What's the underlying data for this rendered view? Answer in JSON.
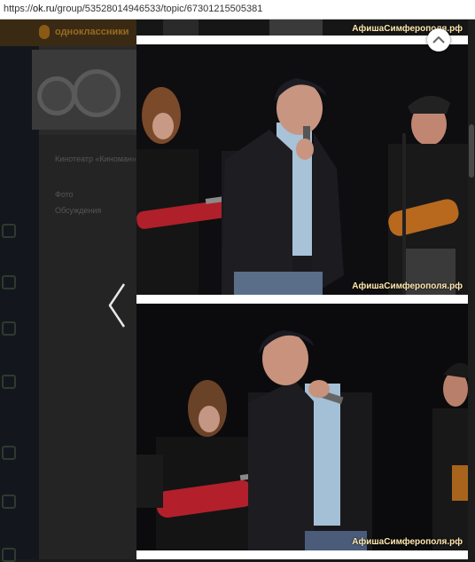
{
  "browser": {
    "url_prefix": "https://",
    "url_host": "ok.ru",
    "url_path": "/group/53528014946533/topic/67301215505381"
  },
  "background_page": {
    "brand": "одноклассники",
    "row1": "Кинотеатр «Киноман»",
    "row2": "Фото",
    "row3": "Обсуждения"
  },
  "viewer": {
    "watermark_top": "АфишаСимферополя.рф",
    "watermark_photo1": "АфишаСимферополя.рф",
    "watermark_photo2": "АфишаСимферополя.рф"
  },
  "icons": {
    "prev": "chevron-left-icon",
    "close": "chevron-up-icon"
  }
}
